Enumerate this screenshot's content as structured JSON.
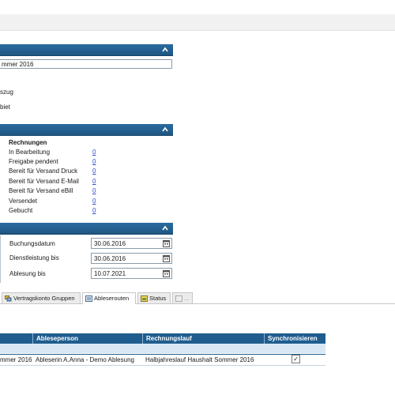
{
  "header": {
    "title_field_value": "mmer 2016"
  },
  "info_lines": [
    "szug",
    "biet"
  ],
  "invoices": {
    "heading": "Rechnungen",
    "rows": [
      {
        "label": "In Bearbeitung",
        "count": "0"
      },
      {
        "label": "Freigabe pendent",
        "count": "0"
      },
      {
        "label": "Bereit für Versand Druck",
        "count": "0"
      },
      {
        "label": "Bereit für Versand E-Mail",
        "count": "0"
      },
      {
        "label": "Bereit für Versand eBill",
        "count": "0"
      },
      {
        "label": "Versendet",
        "count": "0"
      },
      {
        "label": "Gebucht",
        "count": "0"
      }
    ]
  },
  "dates": [
    {
      "label": "Buchungsdatum",
      "value": "30.06.2016",
      "icon": "calendar-icon"
    },
    {
      "label": "Dienstleistung bis",
      "value": "30.06.2016",
      "icon": "calendar-icon"
    },
    {
      "label": "Ablesung bis",
      "value": "10.07.2021",
      "icon": "calendar-icon"
    }
  ],
  "tabs": [
    {
      "label": "Vertragskonto Gruppen",
      "icon": "group-icon"
    },
    {
      "label": "Ableserouten",
      "icon": "route-icon"
    },
    {
      "label": "Status",
      "icon": "status-icon"
    },
    {
      "label": "...",
      "icon": "more-icon"
    }
  ],
  "table": {
    "columns": [
      "Ableseperson",
      "Rechnungslauf",
      "Synchronisieren"
    ],
    "rows": [
      {
        "col0": "mmer 2016",
        "person": "Ableserin A.Anna - Demo Ablesung",
        "run": "Halbjahreslauf Haushalt Sommer 2016",
        "sync": "✓"
      }
    ]
  },
  "colors": {
    "section_header": "#1f5d8e",
    "link": "#2a4bd0",
    "table_header": "#1f5d8e"
  }
}
